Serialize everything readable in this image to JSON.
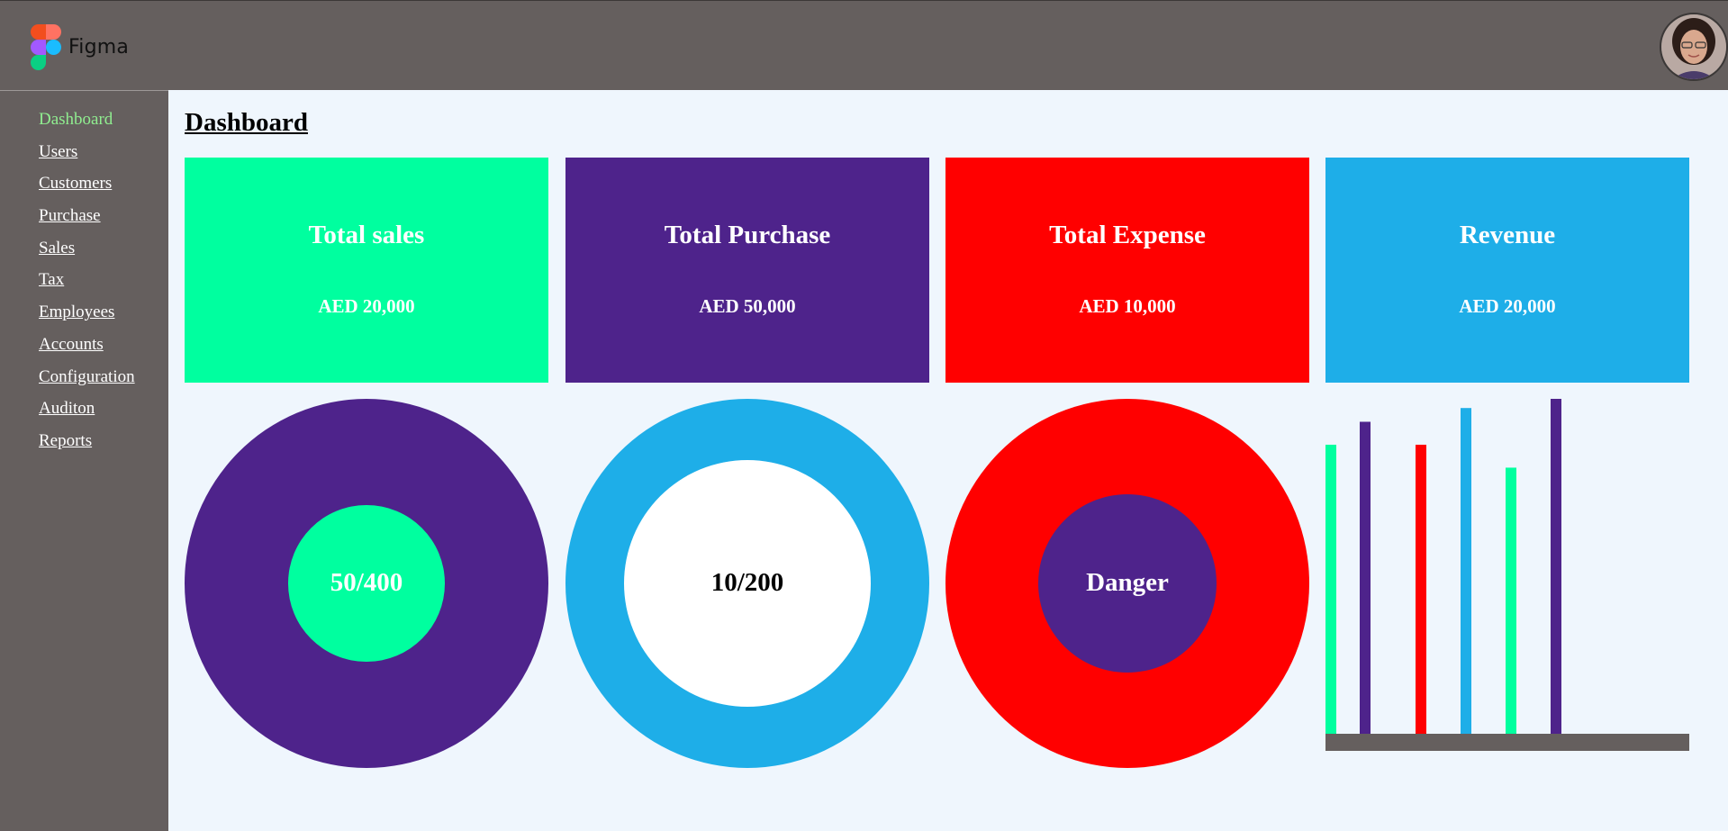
{
  "header": {
    "app_name": "Figma",
    "background": "#655f5e",
    "avatar_icon": "user-avatar"
  },
  "sidebar": {
    "items": [
      {
        "label": "Dashboard",
        "active": true
      },
      {
        "label": "Users"
      },
      {
        "label": "Customers"
      },
      {
        "label": "Purchase"
      },
      {
        "label": "Sales"
      },
      {
        "label": "Tax"
      },
      {
        "label": "Employees"
      },
      {
        "label": "Accounts"
      },
      {
        "label": "Configuration"
      },
      {
        "label": "Auditon"
      },
      {
        "label": "Reports"
      }
    ]
  },
  "main": {
    "title": "Dashboard",
    "cards": [
      {
        "title": "Total sales",
        "value": "AED 20,000",
        "color": "#00ff9f"
      },
      {
        "title": "Total Purchase",
        "value": "AED 50,000",
        "color": "#4e238b"
      },
      {
        "title": "Total Expense",
        "value": "AED 10,000",
        "color": "#ff0000"
      },
      {
        "title": "Revenue",
        "value": "AED 20,000",
        "color": "#1eaee8"
      }
    ],
    "donuts": [
      {
        "label": "50/400",
        "outer_color": "#4e238b",
        "inner_color": "#00ff9f",
        "label_color": "#ffffff",
        "inner_fraction": 0.43
      },
      {
        "label": "10/200",
        "outer_color": "#1eaee8",
        "inner_color": "#ffffff",
        "label_color": "#000000",
        "inner_fraction": 0.68
      },
      {
        "label": "Danger",
        "outer_color": "#ff0000",
        "inner_color": "#4e238b",
        "label_color": "#ffffff",
        "inner_fraction": 0.49
      }
    ]
  },
  "chart_data": {
    "type": "bar",
    "values": [
      63,
      68,
      63,
      71,
      58,
      73
    ],
    "colors": [
      "#00ff9f",
      "#4e238b",
      "#ff0000",
      "#1eaee8",
      "#00ff9f",
      "#4e238b"
    ],
    "ylim": [
      0,
      73
    ],
    "baseline_color": "#655f5e",
    "grid": false
  }
}
